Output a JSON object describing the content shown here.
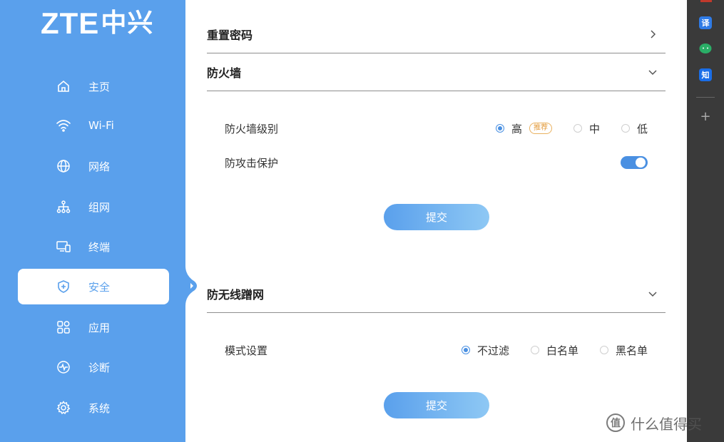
{
  "brand": {
    "latin": "ZTE",
    "cjk": "中兴"
  },
  "sidebar": {
    "items": [
      {
        "label": "主页",
        "icon": "home-icon"
      },
      {
        "label": "Wi-Fi",
        "icon": "wifi-icon"
      },
      {
        "label": "网络",
        "icon": "globe-icon"
      },
      {
        "label": "组网",
        "icon": "mesh-network-icon"
      },
      {
        "label": "终端",
        "icon": "devices-icon"
      },
      {
        "label": "安全",
        "icon": "shield-icon",
        "active": true
      },
      {
        "label": "应用",
        "icon": "apps-icon"
      },
      {
        "label": "诊断",
        "icon": "diagnose-icon"
      },
      {
        "label": "系统",
        "icon": "gear-icon"
      }
    ]
  },
  "sections": {
    "reset_password": {
      "title": "重置密码",
      "state": "collapsed"
    },
    "firewall": {
      "title": "防火墙",
      "state": "expanded",
      "level_label": "防火墙级别",
      "levels": [
        {
          "label": "高",
          "badge": "推荐",
          "checked": true
        },
        {
          "label": "中",
          "checked": false
        },
        {
          "label": "低",
          "checked": false
        }
      ],
      "attack_protection_label": "防攻击保护",
      "attack_protection_on": true,
      "submit": "提交"
    },
    "anti_leech": {
      "title": "防无线蹭网",
      "state": "expanded",
      "mode_label": "模式设置",
      "modes": [
        {
          "label": "不过滤",
          "checked": true
        },
        {
          "label": "白名单",
          "checked": false
        },
        {
          "label": "黑名单",
          "checked": false
        }
      ],
      "submit": "提交"
    }
  },
  "extension_bar": {
    "items": [
      {
        "label": "译",
        "icon": "translate-icon",
        "color": "#2f7be6"
      },
      {
        "label": "",
        "icon": "wechat-icon",
        "color": "#2aae67"
      },
      {
        "label": "知",
        "icon": "zhihu-icon",
        "color": "#1a6ee8"
      }
    ],
    "add": "+"
  },
  "watermark": {
    "badge": "值",
    "text": "什么值得买"
  },
  "colors": {
    "accent": "#5aa0ec",
    "radio": "#4a90e2",
    "badge": "#e39a3a"
  }
}
